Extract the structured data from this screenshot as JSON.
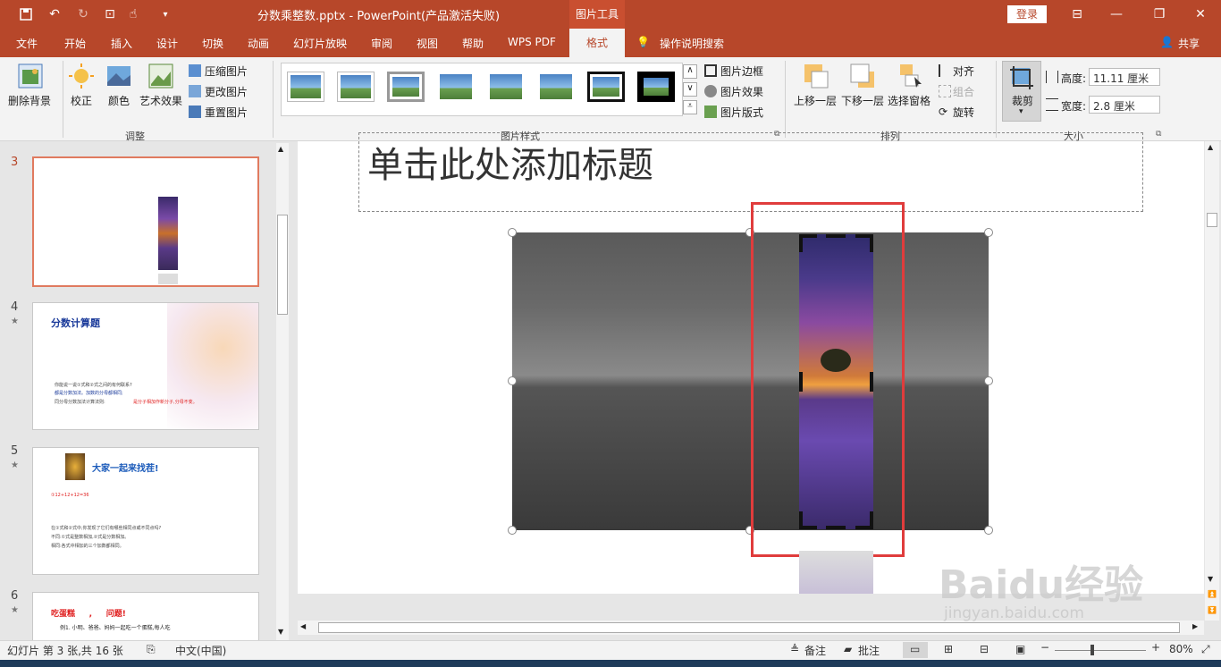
{
  "titlebar": {
    "doc_title": "分数乘整数.pptx  -  PowerPoint(产品激活失败)",
    "context_tools": "图片工具",
    "login": "登录"
  },
  "tabs": [
    "文件",
    "开始",
    "插入",
    "设计",
    "切换",
    "动画",
    "幻灯片放映",
    "审阅",
    "视图",
    "帮助",
    "WPS PDF"
  ],
  "active_tab": "格式",
  "tell_me": "操作说明搜索",
  "share": "共享",
  "ribbon": {
    "remove_bg": "删除背景",
    "correct": "校正",
    "color": "颜色",
    "artistic": "艺术效果",
    "compress": "压缩图片",
    "change": "更改图片",
    "reset": "重置图片",
    "group_adjust": "调整",
    "border": "图片边框",
    "effects": "图片效果",
    "layout": "图片版式",
    "group_styles": "图片样式",
    "bring_forward": "上移一层",
    "send_backward": "下移一层",
    "selection_pane": "选择窗格",
    "align": "对齐",
    "group_btn": "组合",
    "rotate": "旋转",
    "group_arrange": "排列",
    "crop": "裁剪",
    "height_label": "高度:",
    "height_value": "11.11 厘米",
    "width_label": "宽度:",
    "width_value": "2.8 厘米",
    "group_size": "大小"
  },
  "slides": [
    {
      "num": "3",
      "star": ""
    },
    {
      "num": "4",
      "star": "★",
      "title": "分数计算题"
    },
    {
      "num": "5",
      "star": "★",
      "title": "大家一起来找茬!"
    },
    {
      "num": "6",
      "star": "★",
      "title": "吃蛋糕     ,     问题!"
    }
  ],
  "slide4_text": {
    "q": "你能说一说①式和②式之间的有何联系?",
    "a1": "都是分数加法。加数的分母都相同;",
    "a2": "同分母分数加法计算法则:",
    "rule": "是分子相加作新分子,分母不变。"
  },
  "slide5_text": {
    "l1": "①12+12+12=36",
    "l2": "在①式和②式中,你发现了它们有哪些相同点或不同点吗?",
    "l3": "不同:①式是整数相加,②式是分数相加。",
    "l4": "相同:各式中相加的三个加数都相同。"
  },
  "slide6_text": {
    "l1": "例1. 小明、爸爸、妈妈一起吃一个蛋糕,每人吃"
  },
  "editor": {
    "title_placeholder": "单击此处添加标题"
  },
  "statusbar": {
    "slide_info": "幻灯片 第 3 张,共 16 张",
    "language": "中文(中国)",
    "notes": "备注",
    "comments": "批注",
    "zoom": "80%"
  },
  "watermark": {
    "brand": "Baidu经验",
    "url": "jingyan.baidu.com"
  },
  "colors": {
    "accent": "#b7472a",
    "selection_red": "#e03c3c"
  }
}
